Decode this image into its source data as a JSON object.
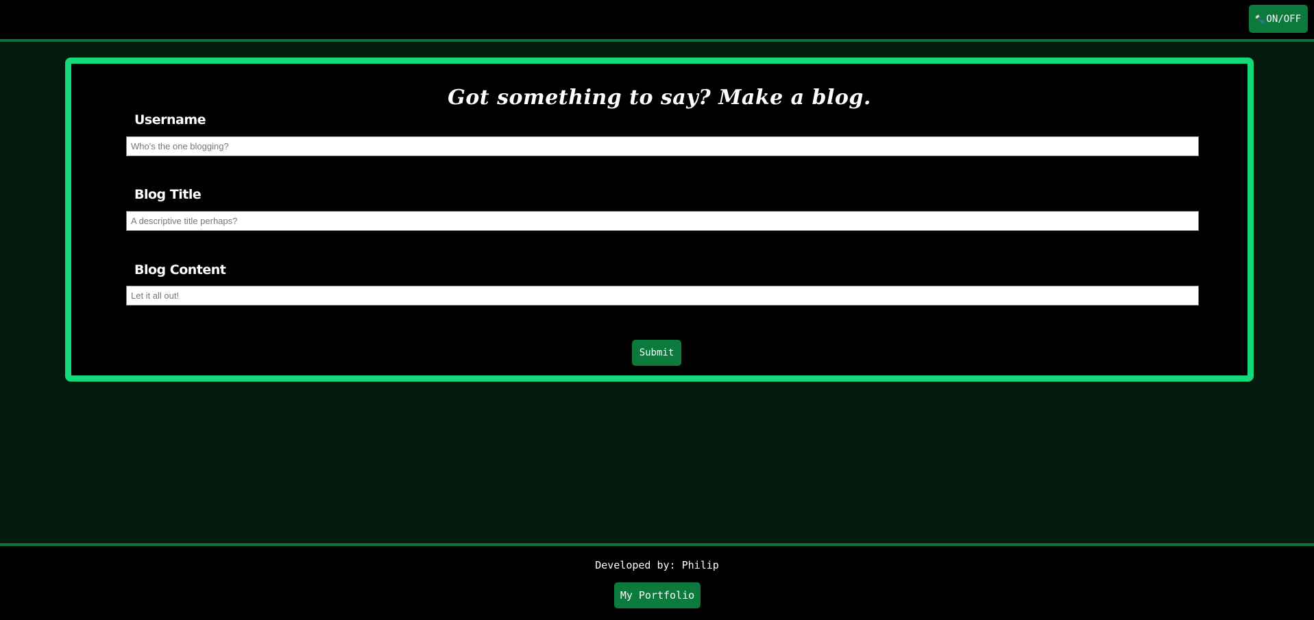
{
  "header": {
    "toggle": {
      "icon": "flashlight-icon",
      "icon_glyph": "🔦",
      "label": "ON/OFF"
    }
  },
  "form": {
    "title": "Got something to say? Make a blog.",
    "fields": [
      {
        "label": "Username",
        "placeholder": "Who's the one blogging?",
        "value": ""
      },
      {
        "label": "Blog Title",
        "placeholder": "A descriptive title perhaps?",
        "value": ""
      },
      {
        "label": "Blog Content",
        "placeholder": "Let it all out!",
        "value": ""
      }
    ],
    "submit_label": "Submit"
  },
  "footer": {
    "credit": "Developed by: Philip",
    "portfolio_label": "My Portfolio"
  },
  "colors": {
    "accent_border": "#14d97a",
    "button": "#0b7a3c",
    "background": "#031a0c",
    "bar": "#000000",
    "divider": "#11753a"
  }
}
